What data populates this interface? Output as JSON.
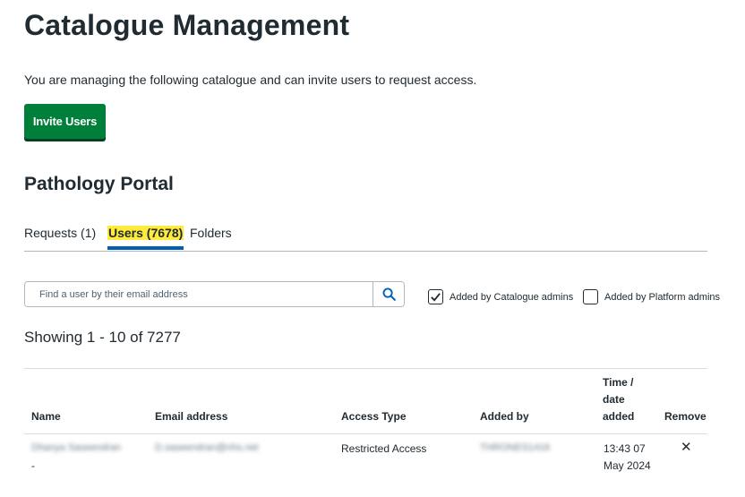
{
  "page": {
    "title": "Catalogue Management",
    "intro": "You are managing the following catalogue and can invite users to request access.",
    "invite_button": "Invite Users"
  },
  "catalogue": {
    "name": "Pathology Portal"
  },
  "tabs": [
    {
      "label": "Requests (1)",
      "active": false
    },
    {
      "label": "Users (7678)",
      "active": true
    },
    {
      "label": "Folders",
      "active": false
    }
  ],
  "search": {
    "placeholder": "Find a user by their email address",
    "icon": "search-icon"
  },
  "filters": {
    "catalogue_admins": {
      "label": "Added by Catalogue admins",
      "checked": true
    },
    "platform_admins": {
      "label": "Added by Platform admins",
      "checked": false
    }
  },
  "results": {
    "showing": "Showing 1 - 10 of 7277"
  },
  "table": {
    "headers": {
      "name": "Name",
      "email": "Email address",
      "access_type": "Access Type",
      "added_by": "Added by",
      "time_added": "Time / date added",
      "remove": "Remove"
    },
    "rows": [
      {
        "name": "Dhanya Saseendran",
        "name_suffix": "-",
        "email": "D.saseendran@nhs.net",
        "access_type": "Restricted Access",
        "added_by": "THRONES1416",
        "time_added": "13:43 07 May 2024",
        "remove": "✕"
      }
    ]
  },
  "colors": {
    "primary_button": "#007f3b",
    "tab_highlight": "#ffeb3b",
    "tab_underline": "#005eb8",
    "search_icon": "#005eb8"
  }
}
